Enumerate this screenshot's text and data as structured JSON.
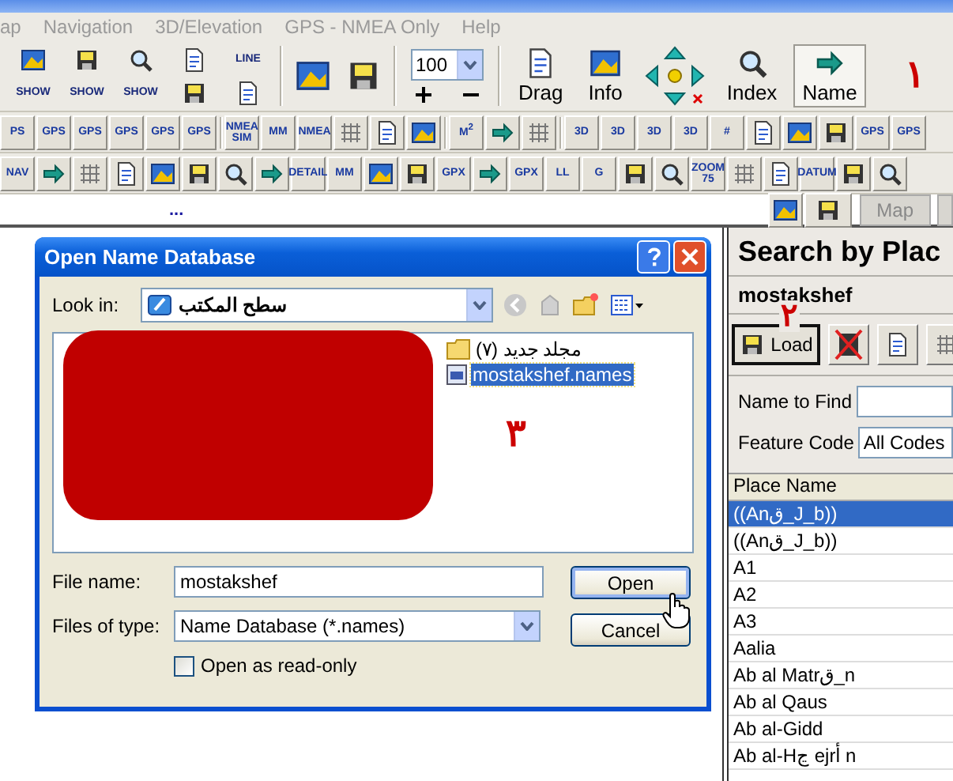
{
  "menu": [
    "ap",
    "Navigation",
    "3D/Elevation",
    "GPS - NMEA Only",
    "Help"
  ],
  "main_toolbar": {
    "items": [
      {
        "kind": "stack",
        "label": "SHOW"
      },
      {
        "kind": "stack",
        "label": "SHOW"
      },
      {
        "kind": "stack",
        "label": "SHOW"
      },
      {
        "kind": "pair"
      },
      {
        "kind": "stack-top",
        "label": "LINE"
      },
      {
        "kind": "sep"
      },
      {
        "kind": "icon"
      },
      {
        "kind": "icon"
      },
      {
        "kind": "sep"
      },
      {
        "kind": "zoom",
        "value": "100"
      },
      {
        "kind": "sep"
      },
      {
        "kind": "big",
        "label": "Drag",
        "selected": false
      },
      {
        "kind": "big",
        "label": "Info",
        "selected": false
      },
      {
        "kind": "pad"
      },
      {
        "kind": "big",
        "label": "Index",
        "selected": false
      },
      {
        "kind": "big",
        "label": "Name",
        "selected": true
      }
    ],
    "annotation": "١"
  },
  "toolbar_2": [
    {
      "kind": "text",
      "label": "PS"
    },
    {
      "kind": "text",
      "label": "GPS"
    },
    {
      "kind": "text",
      "label": "GPS"
    },
    {
      "kind": "text",
      "label": "GPS"
    },
    {
      "kind": "text",
      "label": "GPS"
    },
    {
      "kind": "text",
      "label": "GPS"
    },
    {
      "kind": "sep"
    },
    {
      "kind": "text",
      "label": "NMEA SIM"
    },
    {
      "kind": "text",
      "label": "MM"
    },
    {
      "kind": "text",
      "label": "NMEA"
    },
    {
      "kind": "icon"
    },
    {
      "kind": "icon"
    },
    {
      "kind": "icon"
    },
    {
      "kind": "sep"
    },
    {
      "kind": "text",
      "label": "M$^{2}$"
    },
    {
      "kind": "icon"
    },
    {
      "kind": "icon"
    },
    {
      "kind": "sep"
    },
    {
      "kind": "text",
      "label": "3D"
    },
    {
      "kind": "text",
      "label": "3D"
    },
    {
      "kind": "text",
      "label": "3D"
    },
    {
      "kind": "text",
      "label": "3D"
    },
    {
      "kind": "text",
      "label": "#"
    },
    {
      "kind": "icon"
    },
    {
      "kind": "icon"
    },
    {
      "kind": "icon"
    },
    {
      "kind": "text",
      "label": "GPS"
    },
    {
      "kind": "text",
      "label": "GPS"
    }
  ],
  "toolbar_3": [
    {
      "kind": "text",
      "label": "NAV"
    },
    {
      "kind": "icon"
    },
    {
      "kind": "icon"
    },
    {
      "kind": "icon"
    },
    {
      "kind": "icon"
    },
    {
      "kind": "icon"
    },
    {
      "kind": "icon"
    },
    {
      "kind": "icon"
    },
    {
      "kind": "text",
      "label": "DETAIL"
    },
    {
      "kind": "text",
      "label": "MM"
    },
    {
      "kind": "icon"
    },
    {
      "kind": "icon"
    },
    {
      "kind": "text",
      "label": "GPX"
    },
    {
      "kind": "icon"
    },
    {
      "kind": "text",
      "label": "GPX"
    },
    {
      "kind": "text",
      "label": "LL"
    },
    {
      "kind": "text",
      "label": "G"
    },
    {
      "kind": "icon"
    },
    {
      "kind": "icon"
    },
    {
      "kind": "text",
      "label": "ZOOM 75"
    },
    {
      "kind": "icon"
    },
    {
      "kind": "icon"
    },
    {
      "kind": "text",
      "label": "DATUM"
    },
    {
      "kind": "icon"
    },
    {
      "kind": "icon"
    }
  ],
  "status_strip": {
    "text": "...",
    "tab": "Map"
  },
  "dialog": {
    "title": "Open Name Database",
    "look_in_label": "Look in:",
    "look_in_value": "سطح المكتب",
    "files": [
      {
        "kind": "folder",
        "name": "مجلد جديد (٧)",
        "selected": false
      },
      {
        "kind": "file",
        "name": "mostakshef.names",
        "selected": true
      }
    ],
    "annotation": "٣",
    "file_name_label": "File name:",
    "file_name": "mostakshef",
    "file_type_label": "Files of type:",
    "file_type": "Name Database (*.names)",
    "buttons": [
      "Open",
      "Cancel"
    ],
    "read_only": {
      "label": "Open as read-only",
      "checked": false
    }
  },
  "panel": {
    "title": "Search by Plac",
    "database": "mostakshef",
    "load_button": "Load",
    "annotation": "٢",
    "name_label": "Name to Find",
    "feature_label": "Feature Code",
    "feature_value": "All Codes",
    "column": "Place Name",
    "rows": [
      {
        "name": "((Anق_J_b))",
        "selected": true
      },
      {
        "name": "((Anق_J_b))",
        "selected": false
      },
      {
        "name": "A1",
        "selected": false
      },
      {
        "name": "A2",
        "selected": false
      },
      {
        "name": "A3",
        "selected": false
      },
      {
        "name": "Aalia",
        "selected": false
      },
      {
        "name": "Ab al Matrق_n",
        "selected": false
      },
      {
        "name": "Ab al Qaus",
        "selected": false
      },
      {
        "name": "Ab al-Gidd",
        "selected": false
      },
      {
        "name": "Ab al-Hڃ ejrأ n",
        "selected": false
      }
    ]
  }
}
